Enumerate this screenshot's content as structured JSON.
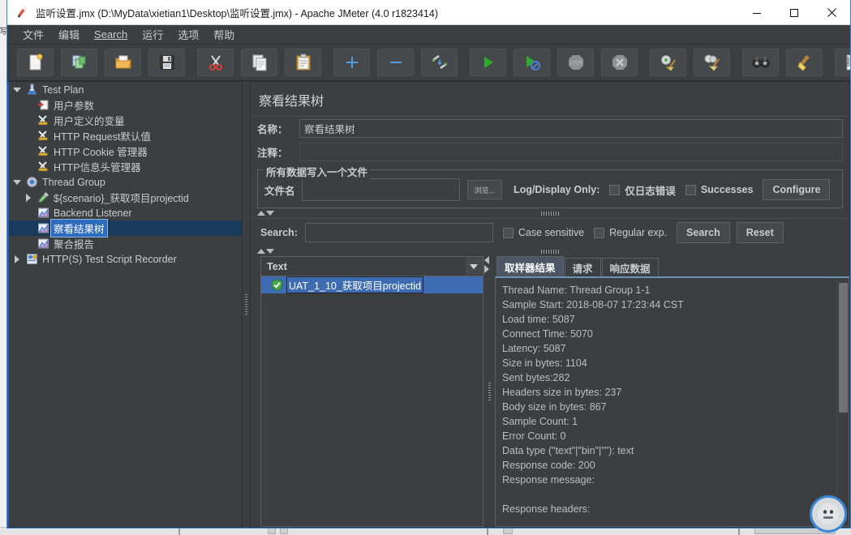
{
  "window": {
    "title": "监听设置.jmx (D:\\MyData\\xietian1\\Desktop\\监听设置.jmx) - Apache JMeter (4.0 r1823414)",
    "app_icon": "jmeter-feather-icon",
    "controls": {
      "minimize": "minimize-icon",
      "maximize": "maximize-icon",
      "close": "close-icon"
    }
  },
  "menubar": {
    "items": [
      {
        "label": "文件",
        "name": "menu-file"
      },
      {
        "label": "编辑",
        "name": "menu-edit"
      },
      {
        "label": "Search",
        "name": "menu-search",
        "mnemonic": "S"
      },
      {
        "label": "运行",
        "name": "menu-run"
      },
      {
        "label": "选项",
        "name": "menu-options"
      },
      {
        "label": "帮助",
        "name": "menu-help"
      }
    ]
  },
  "toolbar": {
    "buttons": [
      {
        "name": "new-button",
        "icon": "new-document-icon"
      },
      {
        "name": "templates-button",
        "icon": "templates-icon"
      },
      {
        "name": "open-button",
        "icon": "open-folder-icon"
      },
      {
        "name": "save-button",
        "icon": "save-floppy-icon"
      },
      {
        "name": "cut-button",
        "icon": "scissors-icon"
      },
      {
        "name": "copy-button",
        "icon": "copy-pages-icon"
      },
      {
        "name": "paste-button",
        "icon": "clipboard-icon"
      },
      {
        "name": "expand-all-button",
        "icon": "plus-icon"
      },
      {
        "name": "collapse-all-button",
        "icon": "minus-icon"
      },
      {
        "name": "toggle-button",
        "icon": "toggle-pencils-icon"
      },
      {
        "name": "start-button",
        "icon": "play-green-icon"
      },
      {
        "name": "start-no-pauses-button",
        "icon": "play-no-pause-icon"
      },
      {
        "name": "stop-button",
        "icon": "stop-sign-icon"
      },
      {
        "name": "shutdown-button",
        "icon": "shutdown-x-icon"
      },
      {
        "name": "clear-button",
        "icon": "gear-broom-icon"
      },
      {
        "name": "clear-all-button",
        "icon": "gears-broom-icon"
      },
      {
        "name": "search-button",
        "icon": "binoculars-icon"
      },
      {
        "name": "reset-search-button",
        "icon": "broom-icon"
      },
      {
        "name": "function-helper-button",
        "icon": "notepad-list-icon"
      }
    ]
  },
  "tree": {
    "nodes": [
      {
        "label": "Test Plan",
        "icon": "test-plan-beaker-icon",
        "indent": 0,
        "toggle": "down",
        "selected": false,
        "name": "tree-node-test-plan"
      },
      {
        "label": "用户参数",
        "icon": "user-parameters-icon",
        "indent": 1,
        "toggle": "none",
        "selected": false,
        "name": "tree-node-user-parameters"
      },
      {
        "label": "用户定义的变量",
        "icon": "config-element-icon",
        "indent": 1,
        "toggle": "none",
        "selected": false,
        "name": "tree-node-user-defined-variables"
      },
      {
        "label": "HTTP Request默认值",
        "icon": "config-element-icon",
        "indent": 1,
        "toggle": "none",
        "selected": false,
        "name": "tree-node-http-request-defaults"
      },
      {
        "label": "HTTP Cookie 管理器",
        "icon": "config-element-icon",
        "indent": 1,
        "toggle": "none",
        "selected": false,
        "name": "tree-node-http-cookie-manager"
      },
      {
        "label": "HTTP信息头管理器",
        "icon": "config-element-icon",
        "indent": 1,
        "toggle": "none",
        "selected": false,
        "name": "tree-node-http-header-manager"
      },
      {
        "label": "Thread Group",
        "icon": "thread-group-gear-icon",
        "indent": 0,
        "toggle": "down",
        "selected": false,
        "name": "tree-node-thread-group"
      },
      {
        "label": "${scenario}_获取项目projectid",
        "icon": "sampler-pen-icon",
        "indent": 1,
        "toggle": "right",
        "selected": false,
        "name": "tree-node-scenario-sampler"
      },
      {
        "label": "Backend Listener",
        "icon": "listener-chart-icon",
        "indent": 1,
        "toggle": "none",
        "selected": false,
        "name": "tree-node-backend-listener"
      },
      {
        "label": "察看结果树",
        "icon": "listener-chart-icon",
        "indent": 1,
        "toggle": "none",
        "selected": true,
        "name": "tree-node-view-results-tree"
      },
      {
        "label": "聚合报告",
        "icon": "listener-chart-icon",
        "indent": 1,
        "toggle": "none",
        "selected": false,
        "name": "tree-node-aggregate-report"
      },
      {
        "label": "HTTP(S) Test Script Recorder",
        "icon": "recorder-icon",
        "indent": 0,
        "toggle": "right",
        "selected": false,
        "name": "tree-node-script-recorder"
      }
    ]
  },
  "panel": {
    "title": "察看结果树",
    "name_label": "名称：",
    "name_value": "察看结果树",
    "comment_label": "注释：",
    "comment_value": "",
    "file_group": {
      "title": "所有数据写入一个文件",
      "filename_label": "文件名",
      "filename_value": "",
      "browse_label": "浏览...",
      "log_display_label": "Log/Display Only:",
      "errors_only_label": "仅日志错误",
      "errors_only_checked": false,
      "successes_label": "Successes",
      "successes_checked": false,
      "configure_label": "Configure"
    },
    "search": {
      "label": "Search:",
      "value": "",
      "case_sensitive_label": "Case sensitive",
      "case_sensitive_checked": false,
      "regex_label": "Regular exp.",
      "regex_checked": false,
      "search_button": "Search",
      "reset_button": "Reset"
    },
    "results": {
      "renderer_selected": "Text",
      "rows": [
        {
          "label": "UAT_1_10_获取项目projectid",
          "status_icon": "success-shield-icon",
          "selected": true
        }
      ]
    },
    "tabs": [
      {
        "label": "取样器结果",
        "active": true,
        "name": "tab-sampler-result"
      },
      {
        "label": "请求",
        "active": false,
        "name": "tab-request"
      },
      {
        "label": "响应数据",
        "active": false,
        "name": "tab-response-data"
      }
    ],
    "sampler_result_lines": [
      "Thread Name: Thread Group 1-1",
      "Sample Start: 2018-08-07 17:23:44 CST",
      "Load time: 5087",
      "Connect Time: 5070",
      "Latency: 5087",
      "Size in bytes: 1104",
      "Sent bytes:282",
      "Headers size in bytes: 237",
      "Body size in bytes: 867",
      "Sample Count: 1",
      "Error Count: 0",
      "Data type (\"text\"|\"bin\"|\"\"): text",
      "Response code: 200",
      "Response message:",
      "",
      "Response headers:"
    ]
  },
  "assistant": {
    "name": "assistant-avatar-icon"
  },
  "colors": {
    "window_bg": "#3c3f41",
    "accent_border": "#3a86d6",
    "selection_blue": "#3d6cb3",
    "tree_selection": "#1a3a5c",
    "text": "#c9cdd1",
    "tab_active": "#4c5664"
  }
}
